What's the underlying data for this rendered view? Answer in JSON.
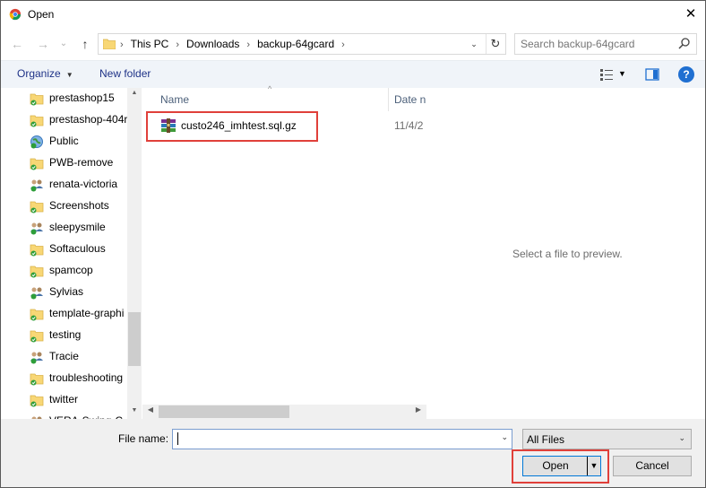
{
  "window": {
    "title": "Open",
    "close_glyph": "✕"
  },
  "nav": {
    "back_glyph": "←",
    "forward_glyph": "→",
    "recent_glyph": "⌄",
    "up_glyph": "↑",
    "breadcrumb": [
      "This PC",
      "Downloads",
      "backup-64gcard"
    ],
    "separator": "›",
    "dropdown_glyph": "⌄",
    "refresh_glyph": "↻"
  },
  "search": {
    "placeholder": "Search backup-64gcard"
  },
  "toolbar": {
    "organize_label": "Organize",
    "organize_arrow": "▼",
    "new_folder_label": "New folder",
    "view_arrow": "▼",
    "help_label": "?"
  },
  "sidebar": {
    "items": [
      {
        "label": "prestashop15",
        "icon": "folder-sync-icon"
      },
      {
        "label": "prestashop-404r",
        "icon": "folder-sync-icon"
      },
      {
        "label": "Public",
        "icon": "globe-icon"
      },
      {
        "label": "PWB-remove",
        "icon": "folder-sync-icon"
      },
      {
        "label": "renata-victoria",
        "icon": "shared-users-icon"
      },
      {
        "label": "Screenshots",
        "icon": "folder-sync-icon"
      },
      {
        "label": "sleepysmile",
        "icon": "shared-users-icon"
      },
      {
        "label": "Softaculous",
        "icon": "folder-sync-icon"
      },
      {
        "label": "spamcop",
        "icon": "folder-sync-icon"
      },
      {
        "label": "Sylvias",
        "icon": "shared-users-icon"
      },
      {
        "label": "template-graphi",
        "icon": "folder-sync-icon"
      },
      {
        "label": "testing",
        "icon": "folder-sync-icon"
      },
      {
        "label": "Tracie",
        "icon": "shared-users-icon"
      },
      {
        "label": "troubleshooting",
        "icon": "folder-sync-icon"
      },
      {
        "label": "twitter",
        "icon": "folder-sync-icon"
      },
      {
        "label": "VERA-Swing-C",
        "icon": "shared-users-icon"
      }
    ]
  },
  "columns": {
    "name": "Name",
    "date": "Date n",
    "sort_glyph": "^"
  },
  "files": [
    {
      "name": "custo246_imhtest.sql.gz",
      "date": "11/4/2",
      "icon": "archive-icon"
    }
  ],
  "preview": {
    "text": "Select a file to preview."
  },
  "bottom": {
    "file_name_label": "File name:",
    "file_name_value": "",
    "file_type": "All Files",
    "dropdown_glyph": "⌄",
    "open_label": "Open",
    "open_split_glyph": "▼",
    "cancel_label": "Cancel"
  },
  "scroll": {
    "up_glyph": "▲",
    "down_glyph": "▼",
    "left_glyph": "◀",
    "right_glyph": "▶"
  },
  "colors": {
    "accent": "#0078d7",
    "highlight": "#e0403a",
    "link": "#1e3287"
  }
}
